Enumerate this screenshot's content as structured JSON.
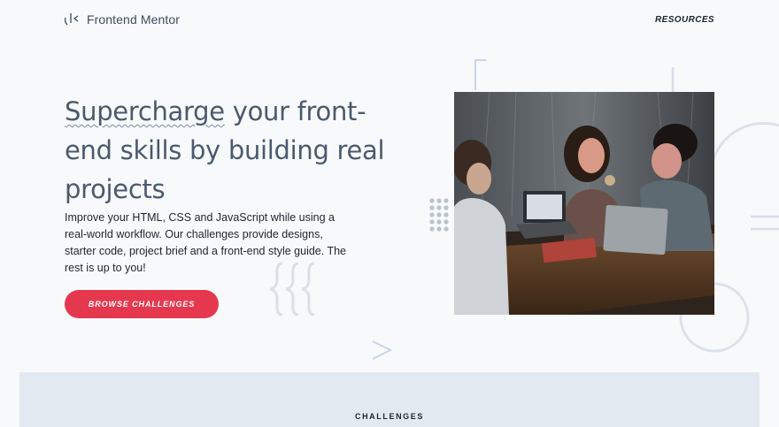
{
  "header": {
    "brand": "Frontend Mentor",
    "nav_resources": "RESOURCES"
  },
  "hero": {
    "title_part1": "Supercharge",
    "title_part2": " your front-end skills by building real projects",
    "description": "Improve your HTML, CSS and JavaScript while using a real-world workflow. Our challenges provide designs, starter code, project brief and a front-end style guide. The rest is up to you!",
    "cta_label": "BROWSE CHALLENGES"
  },
  "section": {
    "title": "CHALLENGES"
  },
  "colors": {
    "accent": "#e5384f",
    "text_dark": "#1e2530",
    "heading": "#4a5a6e",
    "section_bg": "#e2e9f1"
  }
}
